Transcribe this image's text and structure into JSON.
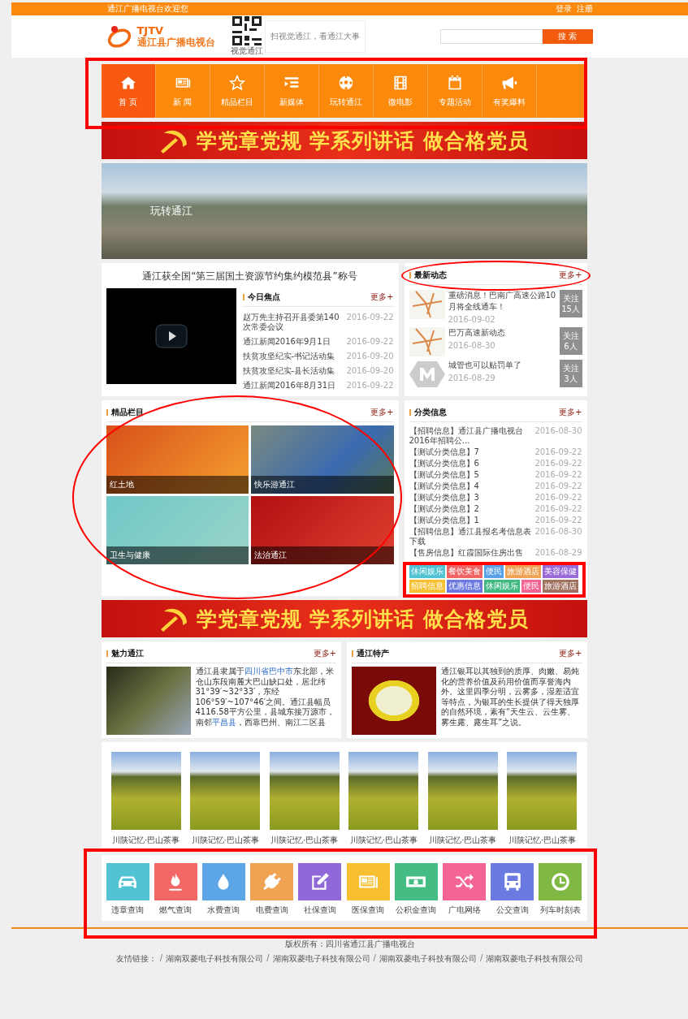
{
  "top_bar": {
    "welcome": "通江广播电视台欢迎您",
    "links": [
      "登录",
      "注册"
    ]
  },
  "header": {
    "logo_en": "TJTV",
    "logo_cn": "通江县广播电视台",
    "qr_caption": "视觉通江",
    "slogan": "扫视觉通江，看通江大事",
    "search_button": "搜 索"
  },
  "nav": [
    {
      "label": "首 页",
      "selected": true
    },
    {
      "label": "新 闻",
      "selected": false
    },
    {
      "label": "精品栏目",
      "selected": false
    },
    {
      "label": "新媒体",
      "selected": false
    },
    {
      "label": "玩转通江",
      "selected": false
    },
    {
      "label": "微电影",
      "selected": false
    },
    {
      "label": "专题活动",
      "selected": false
    },
    {
      "label": "有奖爆料",
      "selected": false
    }
  ],
  "banners": [
    "学党章党规 学系列讲话 做合格党员",
    "学党章党规 学系列讲话 做合格党员"
  ],
  "hero": {
    "caption": "玩转通江"
  },
  "headline": "通江获全国“第三届国土资源节约集约模范县”称号",
  "today": {
    "title": "今日焦点",
    "more": "更多+",
    "items": [
      {
        "title": "赵万先主持召开县委第140次常委会议",
        "date": "2016-09-22"
      },
      {
        "title": "通江新闻2016年9月1日",
        "date": "2016-09-22"
      },
      {
        "title": "扶贫攻坚纪实-书记活动集",
        "date": "2016-09-20"
      },
      {
        "title": "扶贫攻坚纪实-县长活动集",
        "date": "2016-09-20"
      },
      {
        "title": "通江新闻2016年8月31日",
        "date": "2016-09-22"
      }
    ]
  },
  "latest": {
    "title": "最新动态",
    "more": "更多+",
    "items": [
      {
        "title": "重磅消息！巴南广高速公路10月将全线通车！",
        "date": "2016-09-02",
        "follow": "关注",
        "count": "15人"
      },
      {
        "title": "巴万高速新动态",
        "date": "2016-08-30",
        "follow": "关注",
        "count": "6人"
      },
      {
        "title": "城管也可以贴罚单了",
        "date": "2016-08-29",
        "follow": "关注",
        "count": "3人"
      }
    ]
  },
  "programs": {
    "title": "精品栏目",
    "more": "更多+",
    "items": [
      {
        "caption": "红土地"
      },
      {
        "caption": "快乐游通江"
      },
      {
        "caption": "卫生与健康"
      },
      {
        "caption": "法治通江"
      }
    ]
  },
  "classifieds": {
    "title": "分类信息",
    "more": "更多+",
    "items": [
      {
        "title": "【招聘信息】通江县广播电视台2016年招聘公...",
        "date": "2016-08-30"
      },
      {
        "title": "【测试分类信息】7",
        "date": "2016-09-22"
      },
      {
        "title": "【测试分类信息】6",
        "date": "2016-09-22"
      },
      {
        "title": "【测试分类信息】5",
        "date": "2016-09-22"
      },
      {
        "title": "【测试分类信息】4",
        "date": "2016-09-22"
      },
      {
        "title": "【测试分类信息】3",
        "date": "2016-09-22"
      },
      {
        "title": "【测试分类信息】2",
        "date": "2016-09-22"
      },
      {
        "title": "【测试分类信息】1",
        "date": "2016-09-22"
      },
      {
        "title": "【招聘信息】通江县报名考信息表下载",
        "date": "2016-08-30"
      },
      {
        "title": "【售房信息】红霞国际住房出售",
        "date": "2016-08-29"
      }
    ],
    "tags": [
      {
        "label": "休闲娱乐",
        "color": "#4fc3d4"
      },
      {
        "label": "餐饮美食",
        "color": "#f06464"
      },
      {
        "label": "便民",
        "color": "#5aa2e8"
      },
      {
        "label": "旅游酒店",
        "color": "#f0a352"
      },
      {
        "label": "美容保健",
        "color": "#9a6ad8"
      },
      {
        "label": "招聘信息",
        "color": "#f5c132"
      },
      {
        "label": "优惠信息",
        "color": "#6a78e0"
      },
      {
        "label": "休闲娱乐",
        "color": "#42b882"
      },
      {
        "label": "便民",
        "color": "#f06496"
      },
      {
        "label": "旅游酒店",
        "color": "#a07260"
      }
    ]
  },
  "intro": [
    {
      "title": "魅力通江",
      "more": "更多+",
      "text": [
        {
          "text": "通江县隶属于"
        },
        {
          "text": "四川省巴中市",
          "kind": "link"
        },
        {
          "text": "东北部，米仓山东段南麓大巴山缺口处，居北纬31°39′~32°33′，东经106°59′~107°46′之间。通江县幅员4116.58平方公里，县城东接万源市，南邻"
        },
        {
          "text": "平昌县",
          "kind": "link"
        },
        {
          "text": "，西靠巴州、南江二区县"
        }
      ]
    },
    {
      "title": "通江特产",
      "more": "更多+",
      "text": [
        {
          "text": "通江银耳以其独到的质厚、肉嫩、易炖化的营养价值及药用价值而享誉海内外。这里四季分明，云雾多，湿差适宜等特点，为银耳的生长提供了得天独厚的自然环境，素有“天生云、云生雾、雾生露、露生耳”之说。"
        }
      ]
    }
  ],
  "gallery": [
    "川陕记忆·巴山茶事",
    "川陕记忆·巴山茶事",
    "川陕记忆·巴山茶事",
    "川陕记忆·巴山茶事",
    "川陕记忆·巴山茶事",
    "川陕记忆·巴山茶事"
  ],
  "services": [
    {
      "label": "违章查询",
      "color": "#52c3d2"
    },
    {
      "label": "燃气查询",
      "color": "#f36767"
    },
    {
      "label": "水费查询",
      "color": "#5ca6e8"
    },
    {
      "label": "电费查询",
      "color": "#f0a352"
    },
    {
      "label": "社保查询",
      "color": "#9068d8"
    },
    {
      "label": "医保查询",
      "color": "#f8c030"
    },
    {
      "label": "公积金查询",
      "color": "#45bc84"
    },
    {
      "label": "广电网络",
      "color": "#f46496"
    },
    {
      "label": "公交查询",
      "color": "#6a7ae0"
    },
    {
      "label": "列车时刻表",
      "color": "#80b844"
    }
  ],
  "footer": {
    "copyright": "版权所有：四川省通江县广播电视台",
    "links_label": "友情链接：",
    "links": [
      {
        "separator": "/",
        "label": "湖南双菱电子科技有限公司"
      },
      {
        "separator": "/",
        "label": "湖南双菱电子科技有限公司"
      },
      {
        "separator": "/",
        "label": "湖南双菱电子科技有限公司"
      },
      {
        "separator": "/",
        "label": "湖南双菱电子科技有限公司"
      }
    ]
  },
  "annotations": [
    {
      "kind": "rectangle"
    },
    {
      "kind": "ellipse"
    },
    {
      "kind": "ellipse"
    },
    {
      "kind": "rectangle"
    },
    {
      "kind": "rectangle"
    }
  ]
}
